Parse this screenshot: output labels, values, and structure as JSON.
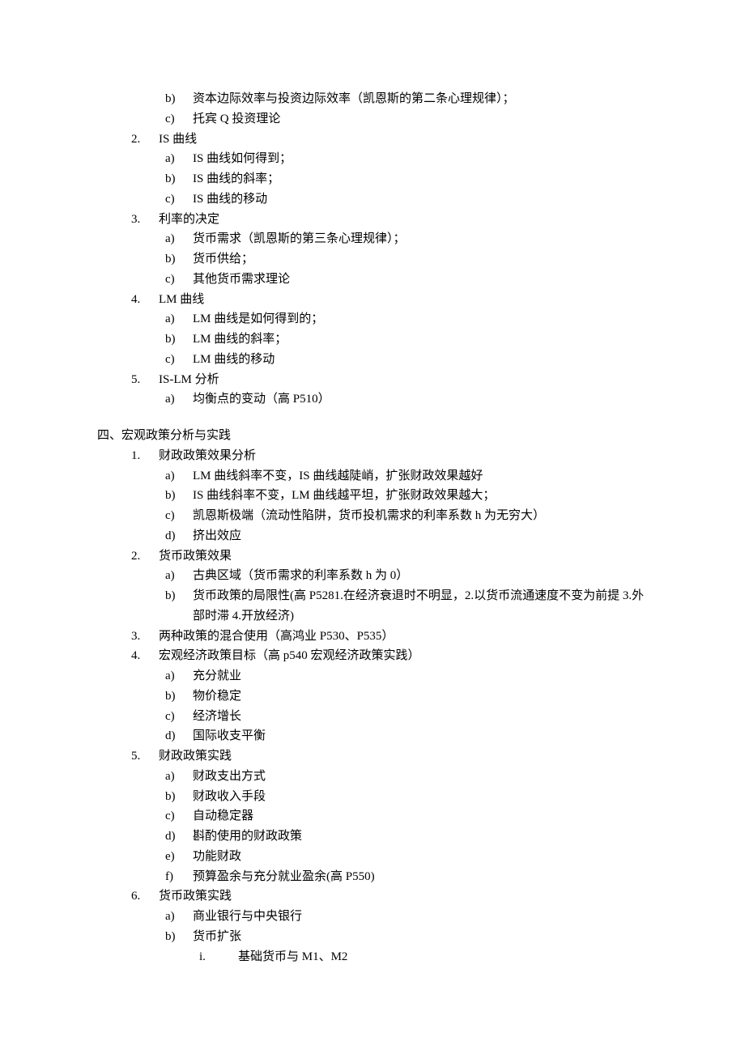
{
  "section3_continued": {
    "item1_continued": [
      {
        "m": "b)",
        "t": "资本边际效率与投资边际效率（凯恩斯的第二条心理规律）；"
      },
      {
        "m": "c)",
        "t": "托宾 Q 投资理论"
      }
    ],
    "item2": {
      "m": "2.",
      "t": "IS 曲线",
      "subs": [
        {
          "m": "a)",
          "t": "IS 曲线如何得到；"
        },
        {
          "m": "b)",
          "t": "IS 曲线的斜率；"
        },
        {
          "m": "c)",
          "t": "IS 曲线的移动"
        }
      ]
    },
    "item3": {
      "m": "3.",
      "t": "利率的决定",
      "subs": [
        {
          "m": "a)",
          "t": "货币需求（凯恩斯的第三条心理规律）；"
        },
        {
          "m": "b)",
          "t": "货币供给；"
        },
        {
          "m": "c)",
          "t": "其他货币需求理论"
        }
      ]
    },
    "item4": {
      "m": "4.",
      "t": "LM 曲线",
      "subs": [
        {
          "m": "a)",
          "t": "LM 曲线是如何得到的；"
        },
        {
          "m": "b)",
          "t": "LM 曲线的斜率；"
        },
        {
          "m": "c)",
          "t": "LM 曲线的移动"
        }
      ]
    },
    "item5": {
      "m": "5.",
      "t": "IS-LM 分析",
      "subs": [
        {
          "m": "a)",
          "t": "均衡点的变动（高 P510）"
        }
      ]
    }
  },
  "section4": {
    "header": "四、宏观政策分析与实践",
    "item1": {
      "m": "1.",
      "t": "财政政策效果分析",
      "subs": [
        {
          "m": "a)",
          "t": "LM 曲线斜率不变，IS 曲线越陡峭，扩张财政效果越好"
        },
        {
          "m": "b)",
          "t": "IS 曲线斜率不变，LM 曲线越平坦，扩张财政效果越大；"
        },
        {
          "m": "c)",
          "t": "凯恩斯极端（流动性陷阱，货币投机需求的利率系数 h 为无穷大）"
        },
        {
          "m": "d)",
          "t": "挤出效应"
        }
      ]
    },
    "item2": {
      "m": "2.",
      "t": "货币政策效果",
      "subs": [
        {
          "m": "a)",
          "t": "古典区域（货币需求的利率系数 h 为 0）"
        },
        {
          "m": "b)",
          "t": "货币政策的局限性(高 P5281.在经济衰退时不明显，2.以货币流通速度不变为前提 3.外部时滞 4.开放经济)"
        }
      ]
    },
    "item3": {
      "m": "3.",
      "t": "两种政策的混合使用（高鸿业 P530、P535）"
    },
    "item4": {
      "m": "4.",
      "t": "宏观经济政策目标（高 p540 宏观经济政策实践）",
      "subs": [
        {
          "m": "a)",
          "t": "充分就业"
        },
        {
          "m": "b)",
          "t": "物价稳定"
        },
        {
          "m": "c)",
          "t": "经济增长"
        },
        {
          "m": "d)",
          "t": "国际收支平衡"
        }
      ]
    },
    "item5": {
      "m": "5.",
      "t": "财政政策实践",
      "subs": [
        {
          "m": "a)",
          "t": "财政支出方式"
        },
        {
          "m": "b)",
          "t": "财政收入手段"
        },
        {
          "m": "c)",
          "t": "自动稳定器"
        },
        {
          "m": "d)",
          "t": "斟酌使用的财政政策"
        },
        {
          "m": "e)",
          "t": "功能财政"
        },
        {
          "m": "f)",
          "t": "预算盈余与充分就业盈余(高 P550)"
        }
      ]
    },
    "item6": {
      "m": "6.",
      "t": "货币政策实践",
      "subs": [
        {
          "m": "a)",
          "t": "商业银行与中央银行"
        },
        {
          "m": "b)",
          "t": "货币扩张",
          "nested": [
            {
              "m": "i.",
              "t": "基础货币与 M1、M2"
            }
          ]
        }
      ]
    }
  }
}
